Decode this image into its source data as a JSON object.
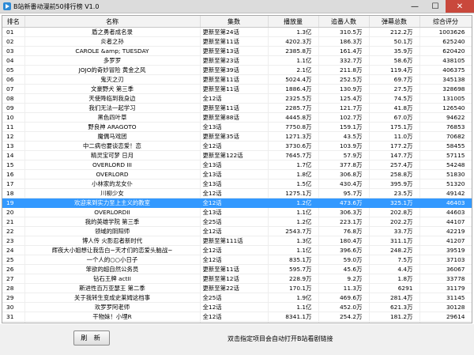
{
  "window": {
    "title": "B站新番动漫前50排行榜 V1.0",
    "min_label": "—",
    "max_label": "☐",
    "close_label": "✕"
  },
  "columns": [
    "排名",
    "名称",
    "集数",
    "播放量",
    "追番人数",
    "弹幕总数",
    "综合评分"
  ],
  "rows": [
    [
      "01",
      "盾之勇者成名录",
      "更新至第24话",
      "1.3亿",
      "310.5万",
      "212.2万",
      "1003626"
    ],
    [
      "02",
      "炎者之孙",
      "更新至第11话",
      "4202.3万",
      "186.3万",
      "50.1万",
      "625240"
    ],
    [
      "03",
      "CAROLE &amp; TUESDAY",
      "更新至第13话",
      "2385.8万",
      "161.4万",
      "35.9万",
      "620420"
    ],
    [
      "04",
      "多罗罗",
      "更新至第23话",
      "1.1亿",
      "332.7万",
      "58.6万",
      "438105"
    ],
    [
      "05",
      "JOJO的奇妙冒险 黄金之风",
      "更新至第39话",
      "2.1亿",
      "211.8万",
      "119.4万",
      "406375"
    ],
    [
      "06",
      "鬼灭之刃",
      "更新至第11话",
      "5024.4万",
      "252.5万",
      "69.7万",
      "345138"
    ],
    [
      "07",
      "文豪野犬 第三季",
      "更新至第11话",
      "1886.4万",
      "130.9万",
      "27.5万",
      "328698"
    ],
    [
      "08",
      "天使降临到我身边",
      "全12话",
      "2325.5万",
      "125.4万",
      "74.5万",
      "131005"
    ],
    [
      "09",
      "我们无法一起学习",
      "更新至第11话",
      "2285.7万",
      "121.7万",
      "41.8万",
      "126540"
    ],
    [
      "10",
      "黑色四叶草",
      "更新至第88话",
      "4445.8万",
      "102.7万",
      "67.0万",
      "94622"
    ],
    [
      "11",
      "野良神 ARAGOTO",
      "全13话",
      "7750.8万",
      "159.1万",
      "175.1万",
      "76853"
    ],
    [
      "12",
      "魔偶马戏团",
      "更新至第35话",
      "1271.3万",
      "43.5万",
      "11.0万",
      "70682"
    ],
    [
      "13",
      "中二病也要谈恋爱！恋",
      "全12话",
      "3730.6万",
      "103.9万",
      "177.2万",
      "58455"
    ],
    [
      "14",
      "精灵宝可梦 日月",
      "更新至第122话",
      "7645.7万",
      "57.9万",
      "147.7万",
      "57115"
    ],
    [
      "15",
      "OVERLORD III",
      "全13话",
      "1.7亿",
      "377.8万",
      "257.4万",
      "54248"
    ],
    [
      "16",
      "OVERLORD",
      "全13话",
      "1.8亿",
      "306.8万",
      "258.8万",
      "51830"
    ],
    [
      "17",
      "小林家的龙女仆",
      "全13话",
      "1.5亿",
      "430.4万",
      "395.9万",
      "51320"
    ],
    [
      "18",
      "川柳少女",
      "全12话",
      "1275.1万",
      "95.7万",
      "23.5万",
      "49142"
    ],
    [
      "19",
      "欢迎来到实力至上主义的教室",
      "全12话",
      "1.2亿",
      "473.6万",
      "325.1万",
      "46403"
    ],
    [
      "20",
      "OVERLORDII",
      "全13话",
      "1.1亿",
      "306.3万",
      "202.8万",
      "44603"
    ],
    [
      "21",
      "我的英雄学院 第三季",
      "全25话",
      "1.2亿",
      "223.1万",
      "202.2万",
      "44107"
    ],
    [
      "22",
      "领域的阴阳师",
      "全12话",
      "2543.7万",
      "76.8万",
      "33.7万",
      "42219"
    ],
    [
      "23",
      "博人传 火影忍者新时代",
      "更新至第111话",
      "1.3亿",
      "180.4万",
      "311.1万",
      "41207"
    ],
    [
      "24",
      "辉夜大小姐想让我告白~天才们的恋爱头脑战~",
      "全12话",
      "1.1亿",
      "396.6万",
      "248.2万",
      "39519"
    ],
    [
      "25",
      "一个人的○○小日子",
      "全12话",
      "835.1万",
      "59.0万",
      "7.5万",
      "37103"
    ],
    [
      "26",
      "笨欲的超自然公务员",
      "更新至第11话",
      "595.7万",
      "45.6万",
      "4.4万",
      "36067"
    ],
    [
      "27",
      "钻石王牌 actII",
      "更新至第12话",
      "228.9万",
      "9.2万",
      "1.8万",
      "33778"
    ],
    [
      "28",
      "斯进性百万亚瑟王 第二季",
      "更新至第22话",
      "170.1万",
      "11.3万",
      "6291",
      "31179"
    ],
    [
      "29",
      "关于我转生变成史莱姆这档事",
      "全25话",
      "1.9亿",
      "469.6万",
      "281.4万",
      "31145"
    ],
    [
      "30",
      "欢罗罗阿老师",
      "全12话",
      "1.1亿",
      "452.0万",
      "621.3万",
      "30128"
    ],
    [
      "31",
      "干物妹！小埋R",
      "全12话",
      "8341.1万",
      "254.2万",
      "181.2万",
      "29614"
    ],
    [
      "32",
      "路人超能100 (灵能百分百)",
      "全12话",
      "6327.4万",
      "255.5万",
      "111.4万",
      "28491"
    ],
    [
      "33",
      "干物妹！小埋",
      "全12话",
      "1.3亿",
      "434.0万",
      "404.1万",
      "27182"
    ],
    [
      "34",
      "青春猪头少年不会梦到兔女郎学姐",
      "全13话",
      "7973.7万",
      "267.3万",
      "178.4万",
      "27144"
    ],
    [
      "35",
      "Charlotte",
      "全13话",
      "6554.2万",
      "211.3万",
      "121.5万",
      "25689"
    ],
    [
      "36",
      "水果篮子 (2019)",
      "更新至第11话",
      "582.3万",
      "59.5万",
      "2.2万",
      "25499"
    ]
  ],
  "selected_rank": "19",
  "bottom": {
    "refresh_label": "刷 新",
    "hint": "双击指定项目会自动打开B站看剧链接"
  }
}
